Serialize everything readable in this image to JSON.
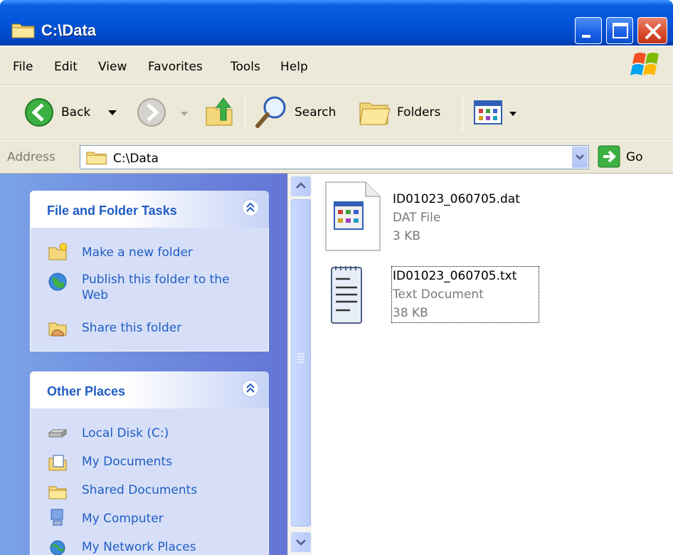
{
  "window": {
    "title": "C:\\Data"
  },
  "menu": {
    "items": [
      "File",
      "Edit",
      "View",
      "Favorites",
      "Tools",
      "Help"
    ]
  },
  "toolbar": {
    "back_label": "Back",
    "search_label": "Search",
    "folders_label": "Folders"
  },
  "address": {
    "label": "Address",
    "value": "C:\\Data",
    "go_label": "Go"
  },
  "tasks": {
    "file_folder": {
      "title": "File and Folder Tasks",
      "items": [
        "Make a new folder",
        "Publish this folder to the Web",
        "Share this folder"
      ]
    },
    "other_places": {
      "title": "Other Places",
      "items": [
        "Local Disk (C:)",
        "My Documents",
        "Shared Documents",
        "My Computer",
        "My Network Places"
      ]
    }
  },
  "files": [
    {
      "name": "ID01023_060705.dat",
      "type": "DAT File",
      "size": "3 KB",
      "selected": false
    },
    {
      "name": "ID01023_060705.txt",
      "type": "Text Document",
      "size": "38 KB",
      "selected": true
    }
  ],
  "colors": {
    "titlebar": "#0254d8",
    "taskpane": "#7ba2e7",
    "link": "#215dc6",
    "chrome": "#ece9d8"
  }
}
